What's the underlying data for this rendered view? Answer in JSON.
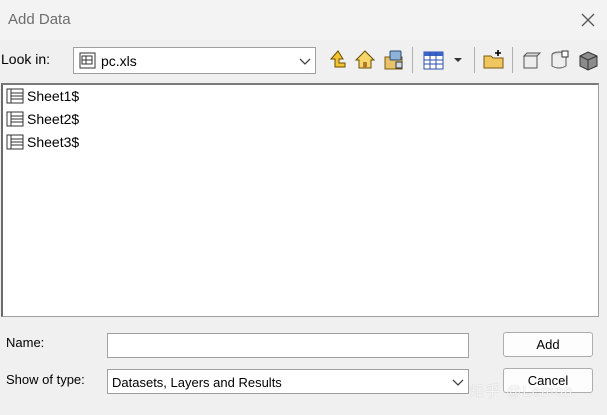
{
  "window": {
    "title": "Add Data"
  },
  "lookin": {
    "label": "Look in:",
    "value": "pc.xls"
  },
  "list": {
    "items": [
      {
        "label": "Sheet1$"
      },
      {
        "label": "Sheet2$"
      },
      {
        "label": "Sheet3$"
      }
    ]
  },
  "name_field": {
    "label": "Name:",
    "value": ""
  },
  "type_field": {
    "label": "Show of type:",
    "value": "Datasets, Layers and Results"
  },
  "buttons": {
    "add": "Add",
    "cancel": "Cancel"
  },
  "watermark": "知乎 @Lemon",
  "colors": {
    "background": "#f0f0f0",
    "title_text": "#6d6d6d",
    "border": "#a0a0a0"
  },
  "icons": {
    "toolbar": [
      "up-one-level-icon",
      "home-icon",
      "connect-folder-icon",
      "view-list-icon",
      "new-folder-icon",
      "new-geodatabase-icon",
      "new-shapefile-icon",
      "new-feature-dataset-icon"
    ]
  }
}
